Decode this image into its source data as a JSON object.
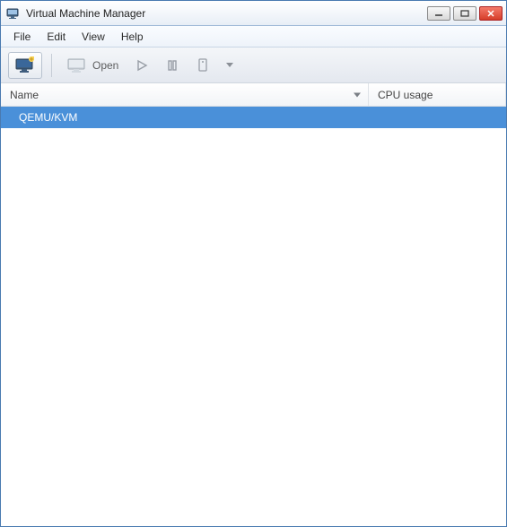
{
  "window": {
    "title": "Virtual Machine Manager"
  },
  "menu": {
    "file": "File",
    "edit": "Edit",
    "view": "View",
    "help": "Help"
  },
  "toolbar": {
    "open_label": "Open"
  },
  "columns": {
    "name": "Name",
    "cpu": "CPU usage"
  },
  "rows": [
    {
      "name": "QEMU/KVM",
      "selected": true
    }
  ]
}
